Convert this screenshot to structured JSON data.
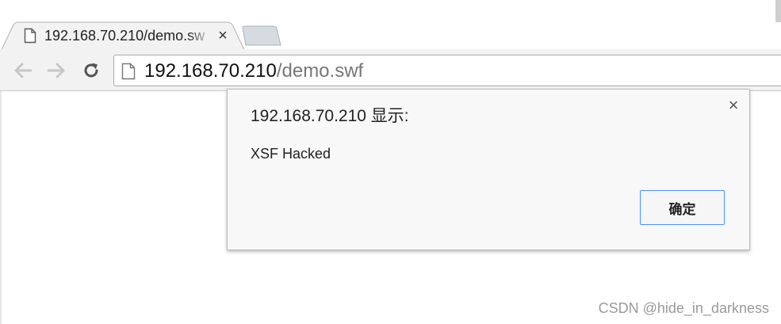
{
  "browser": {
    "tab": {
      "title": "192.168.70.210/demo.sw",
      "close_label": "×",
      "favicon": "page-icon"
    },
    "new_tab_icon": "new-tab-icon",
    "nav": {
      "back_icon": "back-arrow-icon",
      "forward_icon": "forward-arrow-icon",
      "reload_icon": "reload-icon"
    },
    "omnibox": {
      "host": "192.168.70.210",
      "path": "/demo.swf",
      "page_icon": "page-icon"
    }
  },
  "alert": {
    "title": "192.168.70.210 显示:",
    "message": "XSF Hacked",
    "ok_label": "确定",
    "close_label": "×",
    "focus_color": "#4d90fe"
  },
  "watermark": "CSDN @hide_in_darkness"
}
